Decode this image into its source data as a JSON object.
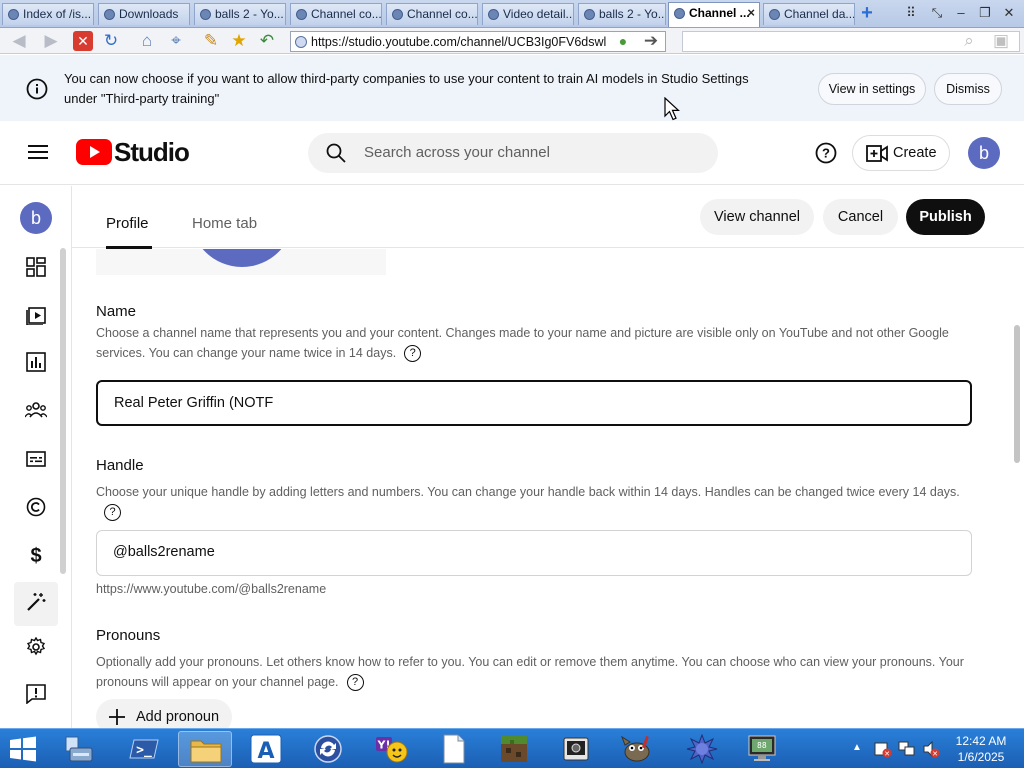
{
  "browser": {
    "tabs": [
      {
        "label": "Index of /is..."
      },
      {
        "label": "Downloads"
      },
      {
        "label": "balls 2 - Yo..."
      },
      {
        "label": "Channel co..."
      },
      {
        "label": "Channel co..."
      },
      {
        "label": "Video detail..."
      },
      {
        "label": "balls 2 - Yo..."
      },
      {
        "label": "Channel ...",
        "active": true
      },
      {
        "label": "Channel da..."
      }
    ],
    "url": "https://studio.youtube.com/channel/UCB3Ig0FV6dswl"
  },
  "banner": {
    "text": "You can now choose if you want to allow third-party companies to use your content to train AI models in Studio Settings under \"Third-party training\"",
    "view_settings_label": "View in settings",
    "dismiss_label": "Dismiss"
  },
  "studio_header": {
    "logo_text": "Studio",
    "search_placeholder": "Search across your channel",
    "create_label": "Create",
    "avatar_letter": "b"
  },
  "left_nav": {
    "avatar_letter": "b",
    "items": [
      {
        "icon": "dashboard-icon"
      },
      {
        "icon": "content-icon"
      },
      {
        "icon": "analytics-icon"
      },
      {
        "icon": "community-icon"
      },
      {
        "icon": "subtitles-icon"
      },
      {
        "icon": "copyright-icon"
      },
      {
        "icon": "earn-icon"
      },
      {
        "icon": "customization-icon",
        "active": true
      },
      {
        "icon": "settings-icon"
      },
      {
        "icon": "feedback-icon"
      }
    ]
  },
  "editor": {
    "tabs": [
      {
        "label": "Profile",
        "active": true
      },
      {
        "label": "Home tab"
      }
    ],
    "view_channel_label": "View channel",
    "cancel_label": "Cancel",
    "publish_label": "Publish"
  },
  "form": {
    "name": {
      "heading": "Name",
      "description": "Choose a channel name that represents you and your content. Changes made to your name and picture are visible only on YouTube and not other Google services. You can change your name twice in 14 days.",
      "value": "Real Peter Griffin (NOTF"
    },
    "handle": {
      "heading": "Handle",
      "description": "Choose your unique handle by adding letters and numbers. You can change your handle back within 14 days. Handles can be changed twice every 14 days.",
      "value": "@balls2rename",
      "url": "https://www.youtube.com/@balls2rename"
    },
    "pronouns": {
      "heading": "Pronouns",
      "description": "Optionally add your pronouns. Let others know how to refer to you. You can edit or remove them anytime. You can choose who can view your pronouns. Your pronouns will appear on your channel page.",
      "add_label": "Add pronoun"
    }
  },
  "taskbar": {
    "time": "12:42 AM",
    "date": "1/6/2025"
  }
}
